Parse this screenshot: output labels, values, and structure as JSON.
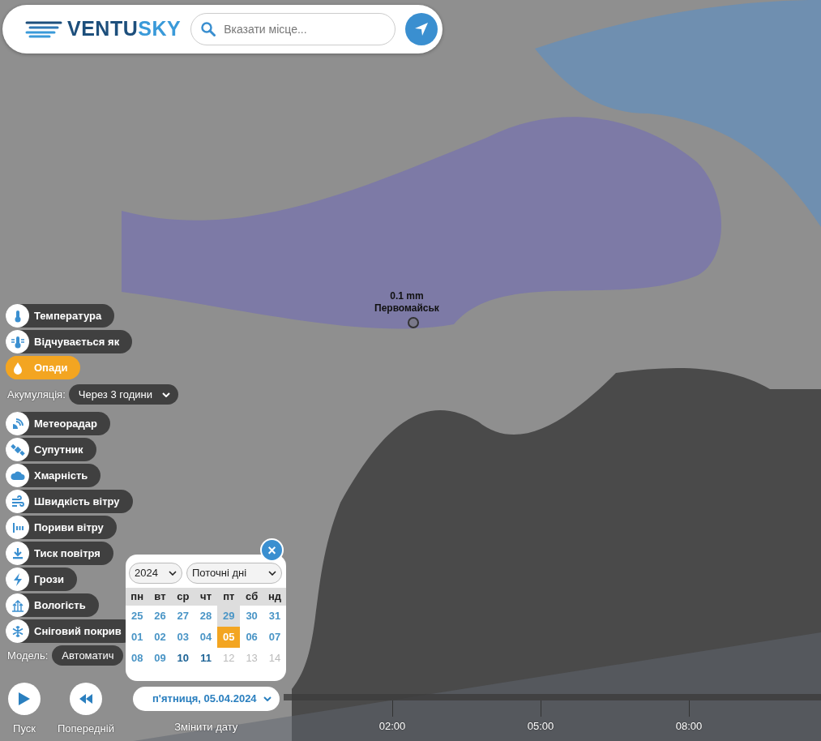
{
  "header": {
    "logo_left": "VENTU",
    "logo_right": "SKY",
    "search": {
      "placeholder": "Вказати місце..."
    }
  },
  "location_marker": {
    "value": "0.1 mm",
    "place": "Первомайськ"
  },
  "layers_top": [
    {
      "label": "Температура",
      "selected": false
    },
    {
      "label": "Відчувається як",
      "selected": false
    },
    {
      "label": "Опади",
      "selected": true
    }
  ],
  "accumulation": {
    "label": "Акумуляція:",
    "value": "Через 3 години"
  },
  "layers_more": [
    {
      "label": "Метеорадар",
      "selected": false
    },
    {
      "label": "Супутник",
      "selected": false
    },
    {
      "label": "Хмарність",
      "selected": false
    },
    {
      "label": "Швидкість вітру",
      "selected": false
    },
    {
      "label": "Пориви вітру",
      "selected": false
    },
    {
      "label": "Тиск повітря",
      "selected": false
    },
    {
      "label": "Грози",
      "selected": false
    },
    {
      "label": "Вологість",
      "selected": false
    },
    {
      "label": "Сніговий покрив",
      "selected": false
    }
  ],
  "model": {
    "label": "Модель:",
    "value": "Автоматич"
  },
  "calendar": {
    "year": "2024",
    "period": "Поточні дні",
    "close": "×",
    "weekdays": [
      "пн",
      "вт",
      "ср",
      "чт",
      "пт",
      "сб",
      "нд"
    ],
    "weeks": [
      [
        {
          "day": "25",
          "kind": "normal",
          "highlighted": false,
          "selected": false
        },
        {
          "day": "26",
          "kind": "normal",
          "highlighted": false,
          "selected": false
        },
        {
          "day": "27",
          "kind": "normal",
          "highlighted": false,
          "selected": false
        },
        {
          "day": "28",
          "kind": "normal",
          "highlighted": false,
          "selected": false
        },
        {
          "day": "29",
          "kind": "normal",
          "highlighted": true,
          "selected": false
        },
        {
          "day": "30",
          "kind": "normal",
          "highlighted": false,
          "selected": false
        },
        {
          "day": "31",
          "kind": "normal",
          "highlighted": false,
          "selected": false
        }
      ],
      [
        {
          "day": "01",
          "kind": "normal",
          "highlighted": false,
          "selected": false
        },
        {
          "day": "02",
          "kind": "normal",
          "highlighted": false,
          "selected": false
        },
        {
          "day": "03",
          "kind": "normal",
          "highlighted": false,
          "selected": false
        },
        {
          "day": "04",
          "kind": "normal",
          "highlighted": false,
          "selected": false
        },
        {
          "day": "05",
          "kind": "normal",
          "highlighted": false,
          "selected": true
        },
        {
          "day": "06",
          "kind": "normal",
          "highlighted": false,
          "selected": false
        },
        {
          "day": "07",
          "kind": "normal",
          "highlighted": false,
          "selected": false
        }
      ],
      [
        {
          "day": "08",
          "kind": "normal",
          "highlighted": false,
          "selected": false
        },
        {
          "day": "09",
          "kind": "normal",
          "highlighted": false,
          "selected": false
        },
        {
          "day": "10",
          "kind": "strong",
          "highlighted": false,
          "selected": false
        },
        {
          "day": "11",
          "kind": "strong",
          "highlighted": false,
          "selected": false
        },
        {
          "day": "12",
          "kind": "disabled",
          "highlighted": false,
          "selected": false
        },
        {
          "day": "13",
          "kind": "disabled",
          "highlighted": false,
          "selected": false
        },
        {
          "day": "14",
          "kind": "disabled",
          "highlighted": false,
          "selected": false
        }
      ]
    ]
  },
  "controls": {
    "play": "Пуск",
    "previous": "Попередній",
    "date": "п'ятниця, 05.04.2024",
    "change_date": "Змінити дату"
  },
  "timeline": {
    "ticks": [
      "02:00",
      "05:00",
      "08:00"
    ]
  }
}
